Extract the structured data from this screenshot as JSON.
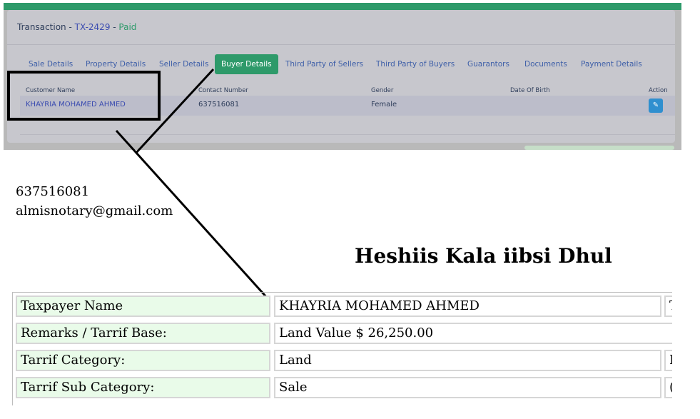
{
  "transaction": {
    "label": "Transaction",
    "sep1": " - ",
    "id": "TX-2429",
    "sep2": " - ",
    "status": "Paid"
  },
  "tabs": [
    {
      "label": "Sale Details"
    },
    {
      "label": "Property Details"
    },
    {
      "label": "Seller Details"
    },
    {
      "label": "Buyer Details",
      "active": true
    },
    {
      "label": "Third Party of Sellers"
    },
    {
      "label": "Third Party of Buyers"
    },
    {
      "label": "Guarantors"
    },
    {
      "label": "Documents"
    },
    {
      "label": "Payment Details"
    }
  ],
  "buyer_table": {
    "headers": {
      "name": "Customer Name",
      "contact": "Contact Number",
      "gender": "Gender",
      "dob": "Date Of Birth",
      "action": "Action"
    },
    "row": {
      "name": "KHAYRIA MOHAMED AHMED",
      "contact": "637516081",
      "gender": "Female",
      "dob": ""
    }
  },
  "document": {
    "phone": "637516081",
    "email": "almisnotary@gmail.com",
    "title": "Heshiis Kala iibsi Dhul",
    "rows": [
      {
        "label": "Taxpayer Name",
        "value": "KHAYRIA MOHAMED AHMED",
        "extra": "T"
      },
      {
        "label": "Remarks / Tarrif Base:",
        "value": "Land Value $ 26,250.00",
        "extra": ""
      },
      {
        "label": "Tarrif Category:",
        "value": "Land",
        "extra": "I"
      },
      {
        "label": "Tarrif Sub Category:",
        "value": "Sale",
        "extra": "("
      }
    ]
  },
  "colors": {
    "accent": "#2e9a6a",
    "link": "#3a4bb0",
    "label_bg": "#e9fbe9",
    "edit_button": "#2f8fcf"
  },
  "icons": {
    "edit": "pencil-icon"
  }
}
